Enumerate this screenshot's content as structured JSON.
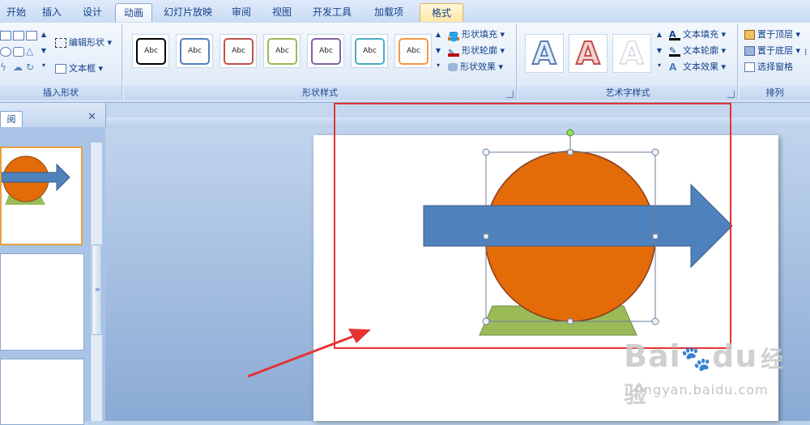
{
  "tabs": [
    {
      "label": "开始",
      "state": "normal"
    },
    {
      "label": "插入",
      "state": "normal"
    },
    {
      "label": "设计",
      "state": "normal"
    },
    {
      "label": "动画",
      "state": "active"
    },
    {
      "label": "幻灯片放映",
      "state": "normal"
    },
    {
      "label": "审阅",
      "state": "normal"
    },
    {
      "label": "视图",
      "state": "normal"
    },
    {
      "label": "开发工具",
      "state": "normal"
    },
    {
      "label": "加载项",
      "state": "normal"
    },
    {
      "label": "格式",
      "state": "context"
    }
  ],
  "ribbon": {
    "insert_shapes": {
      "group_label": "插入形状",
      "edit_shape": "编辑形状 ▾",
      "text_box": "文本框 ▾"
    },
    "shape_styles": {
      "group_label": "形状样式",
      "swatch_text": "Abc",
      "swatch_colors": [
        "#000000",
        "#4f81bd",
        "#c0504d",
        "#9bbb59",
        "#8064a2",
        "#4bacc6",
        "#f79646"
      ],
      "shape_fill": "形状填充 ▾",
      "shape_outline": "形状轮廓 ▾",
      "shape_effects": "形状效果 ▾"
    },
    "wordart": {
      "group_label": "艺术字样式",
      "letter": "A",
      "text_fill": "文本填充 ▾",
      "text_outline": "文本轮廓 ▾",
      "text_effects": "文本效果 ▾"
    },
    "arrange": {
      "group_label": "排列",
      "bring_front": "置于顶层 ▾",
      "send_back": "置于底层 ▾",
      "selection_pane": "选择窗格"
    }
  },
  "panel": {
    "tab_label": "阅",
    "close": "✕"
  },
  "colors": {
    "arrow": "#4f81bd",
    "circle": "#e36c09",
    "triangle": "#9bbb59",
    "highlight": "#e53333"
  },
  "watermark": {
    "brand": "Bai",
    "brand2": "du",
    "cn": "经验",
    "url": "jingyan.baidu.com"
  }
}
